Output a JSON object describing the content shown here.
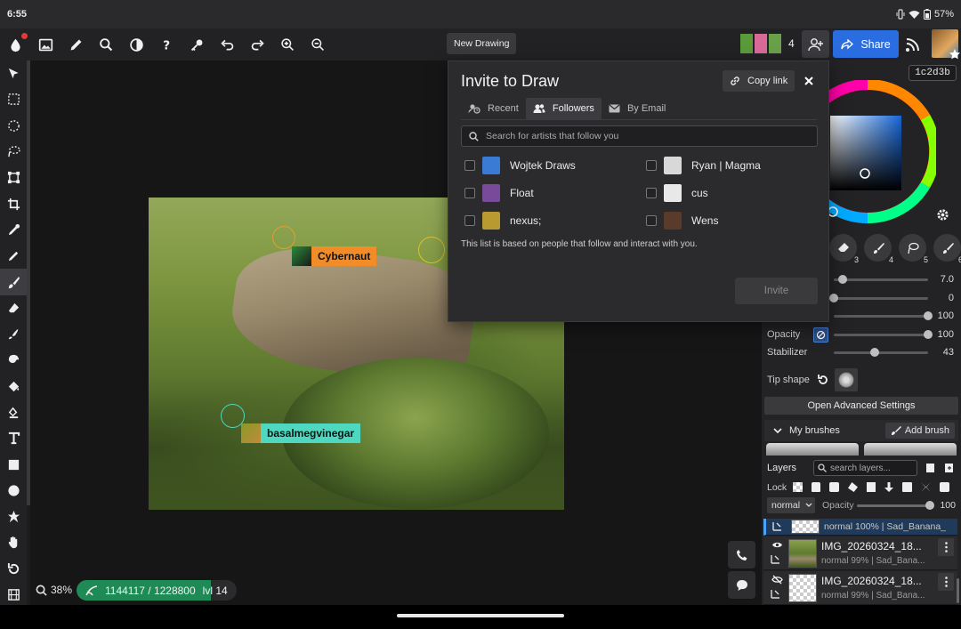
{
  "status_bar": {
    "time": "6:55",
    "battery": "57%"
  },
  "toolbar": {
    "new_drawing": "New Drawing",
    "collaborators_count": "4",
    "share_label": "Share"
  },
  "canvas": {
    "zoom": "38%",
    "xp_text": "1144117 / 1228800",
    "level": "lvl 14",
    "xp_progress": 0.931,
    "cursors": [
      {
        "name": "Cybernaut",
        "color": "#f28c28"
      },
      {
        "name": "basalmegvinegar",
        "color": "#4fd8c0"
      }
    ]
  },
  "color_panel": {
    "hex": "1c2d3b"
  },
  "brush_panel": {
    "brush_numbers": [
      "3",
      "4",
      "5",
      "6"
    ],
    "sliders": [
      {
        "label": "",
        "value": "7.0",
        "pos": 0.09
      },
      {
        "label": "",
        "value": "0",
        "pos": 0.0
      },
      {
        "label": "",
        "value": "100",
        "pos": 1.0
      },
      {
        "label": "Opacity",
        "value": "100",
        "pos": 1.0
      },
      {
        "label": "Stabilizer",
        "value": "43",
        "pos": 0.43
      }
    ],
    "tip_shape": "Tip shape",
    "advanced": "Open Advanced Settings",
    "my_brushes": "My brushes",
    "add_brush": "Add brush"
  },
  "layers_panel": {
    "title": "Layers",
    "search_placeholder": "search layers...",
    "lock": "Lock",
    "blend": "normal",
    "opacity_label": "Opacity",
    "opacity_value": "100",
    "layers": [
      {
        "name": "",
        "meta": "normal 100% | Sad_Banana_"
      },
      {
        "name": "IMG_20260324_18...",
        "meta": "normal 99% | Sad_Bana..."
      },
      {
        "name": "IMG_20260324_18...",
        "meta": "normal 99% | Sad_Bana..."
      }
    ]
  },
  "invite_modal": {
    "title": "Invite to Draw",
    "copy_link": "Copy link",
    "tabs": [
      "Recent",
      "Followers",
      "By Email"
    ],
    "search_placeholder": "Search for artists that follow you",
    "followers": [
      {
        "name": "Wojtek Draws",
        "avatar_color": "#3a7bd5"
      },
      {
        "name": "Ryan | Magma",
        "avatar_color": "#d8d8d8"
      },
      {
        "name": "Float",
        "avatar_color": "#7a4a9a"
      },
      {
        "name": "cus",
        "avatar_color": "#e8e8e8"
      },
      {
        "name": "nexus;",
        "avatar_color": "#b89a30"
      },
      {
        "name": "Wens",
        "avatar_color": "#5a3a2a"
      }
    ],
    "note": "This list is based on people that follow and interact with you.",
    "invite_button": "Invite"
  }
}
